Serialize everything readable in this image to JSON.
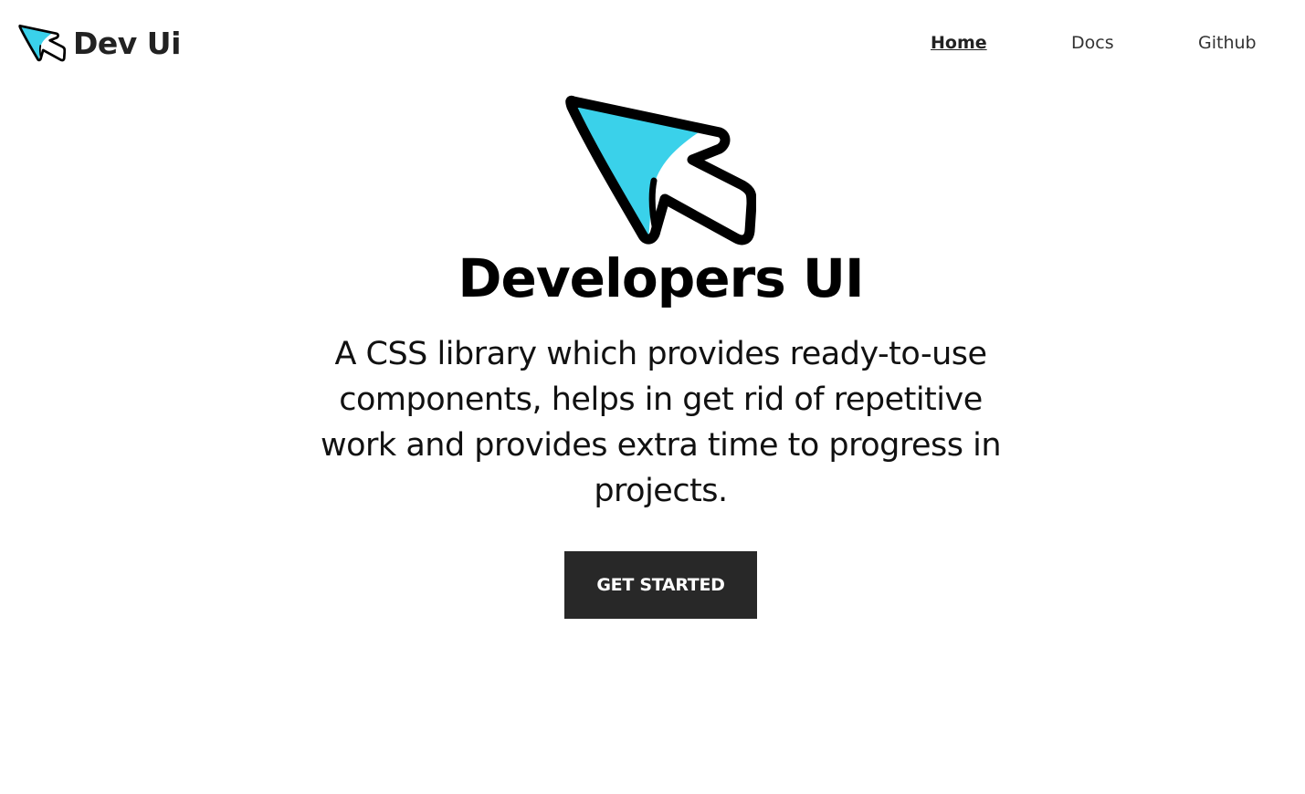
{
  "brand": {
    "name": "Dev Ui",
    "logo_icon": "cursor-arrow-icon"
  },
  "nav": {
    "items": [
      {
        "label": "Home",
        "active": true
      },
      {
        "label": "Docs",
        "active": false
      },
      {
        "label": "Github",
        "active": false
      }
    ]
  },
  "hero": {
    "logo_icon": "cursor-arrow-icon",
    "title": "Developers UI",
    "description": "A CSS library which provides ready-to-use components, helps in get rid of repetitive work and provides extra time to progress in projects.",
    "cta_label": "GET STARTED"
  },
  "colors": {
    "accent": "#3ad1ea",
    "button_bg": "#282828",
    "text": "#111111",
    "background": "#ffffff"
  }
}
